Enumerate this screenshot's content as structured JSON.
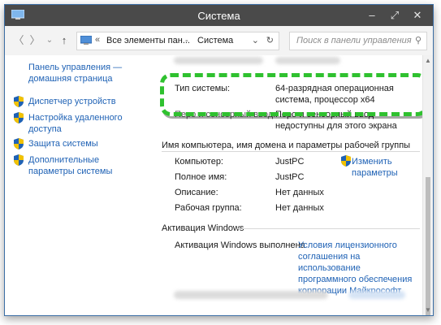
{
  "window": {
    "title": "Система",
    "min_label": "–",
    "max_label": "⤢",
    "close_label": "✕"
  },
  "nav": {
    "back_label": "〈",
    "forward_label": "〉",
    "recent_label": "⌄",
    "up_label": "↑"
  },
  "address": {
    "sep1": "«",
    "crumb1": "Все элементы пан...",
    "sep2": "-",
    "crumb2": "Система",
    "dropdown_label": "⌄",
    "refresh_label": "↻"
  },
  "search": {
    "placeholder": "Поиск в панели управления",
    "icon_label": "⚲"
  },
  "sidebar": {
    "home_link": "Панель управления — домашняя страница",
    "items": [
      {
        "label": "Диспетчер устройств"
      },
      {
        "label": "Настройка удаленного доступа"
      },
      {
        "label": "Защита системы"
      },
      {
        "label": "Дополнительные параметры системы"
      }
    ]
  },
  "system": {
    "type_label": "Тип системы:",
    "type_value": "64-разрядная операционная система, процессор x64",
    "pen_label": "Перо и сенсорный ввод:",
    "pen_value": "Перо и сенсорный ввод недоступны для этого экрана"
  },
  "computer": {
    "section_title": "Имя компьютера, имя домена и параметры рабочей группы",
    "rows": [
      {
        "label": "Компьютер:",
        "value": "JustPC"
      },
      {
        "label": "Полное имя:",
        "value": "JustPC"
      },
      {
        "label": "Описание:",
        "value": "Нет данных"
      },
      {
        "label": "Рабочая группа:",
        "value": "Нет данных"
      }
    ],
    "change_link": "Изменить параметры"
  },
  "activation": {
    "section_title": "Активация Windows",
    "status": "Активация Windows выполнена",
    "license_link": "Условия лицензионного соглашения на использование программного обеспечения корпорации Майкрософт"
  },
  "colors": {
    "titlebar": "#4a4a4a",
    "link": "#1f62b5",
    "highlight": "#2fc12f"
  }
}
